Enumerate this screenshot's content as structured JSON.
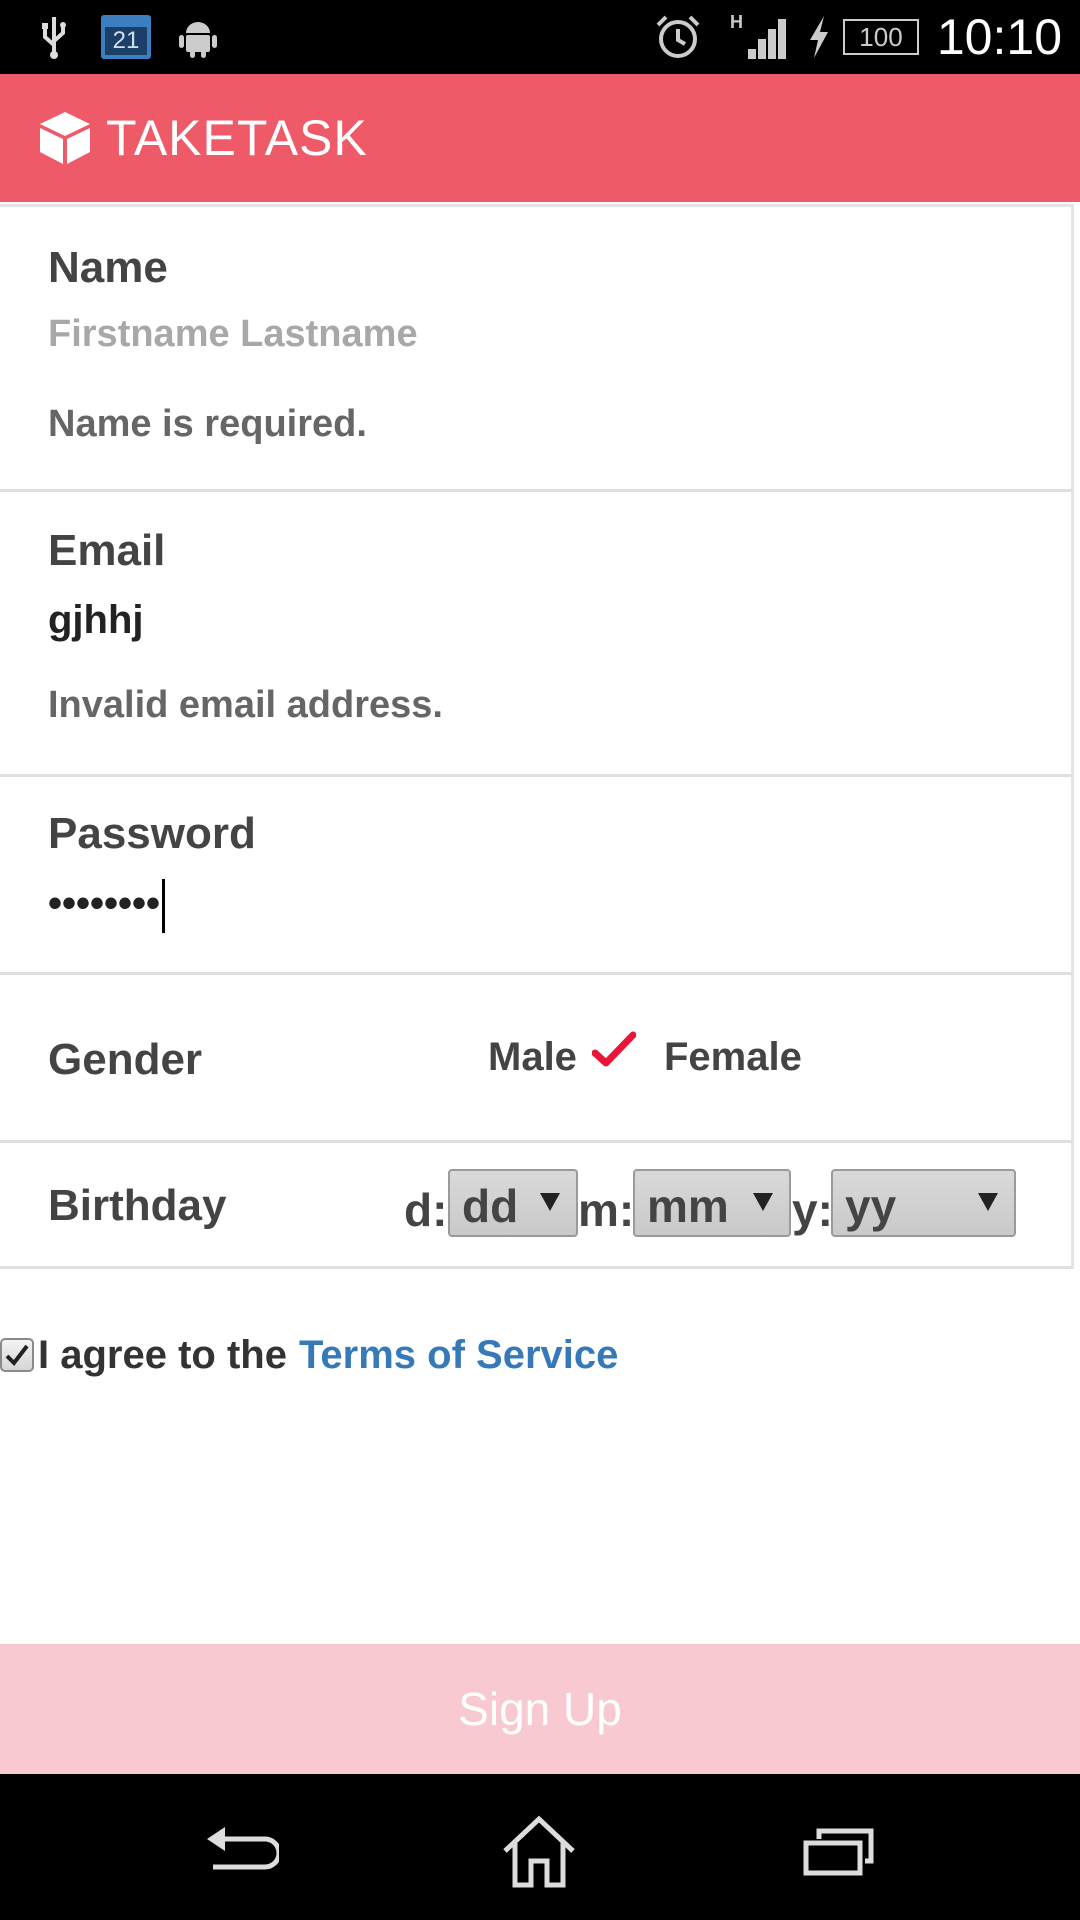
{
  "status_bar": {
    "time": "10:10",
    "calendar_day": "21",
    "battery": "100",
    "network": "H",
    "icons": [
      "usb-icon",
      "calendar-icon",
      "android-icon",
      "alarm-icon",
      "signal-icon",
      "charging-icon",
      "battery-icon"
    ]
  },
  "app_bar": {
    "title": "TAKETASK",
    "logo_icon": "cube-icon",
    "color": "#ee5a68"
  },
  "form": {
    "name": {
      "label": "Name",
      "placeholder": "Firstname Lastname",
      "value": "",
      "error": "Name is required."
    },
    "email": {
      "label": "Email",
      "value": "gjhhj",
      "error": "Invalid email address."
    },
    "password": {
      "label": "Password",
      "masked_value": "••••••••"
    },
    "gender": {
      "label": "Gender",
      "options": [
        "Male",
        "Female"
      ],
      "selected": "Male",
      "check_color": "#e8173a"
    },
    "birthday": {
      "label": "Birthday",
      "day_prefix": "d:",
      "month_prefix": "m:",
      "year_prefix": "y:",
      "day_value": "dd",
      "month_value": "mm",
      "year_value": "yy"
    },
    "agree": {
      "checked": true,
      "text": "I agree to the",
      "link_text": "Terms of Service",
      "link_color": "#3579b8"
    }
  },
  "signup_button": {
    "label": "Sign Up",
    "background": "#f9c9d1"
  },
  "nav_bar": {
    "icons": [
      "back-icon",
      "home-icon",
      "recent-apps-icon"
    ]
  }
}
